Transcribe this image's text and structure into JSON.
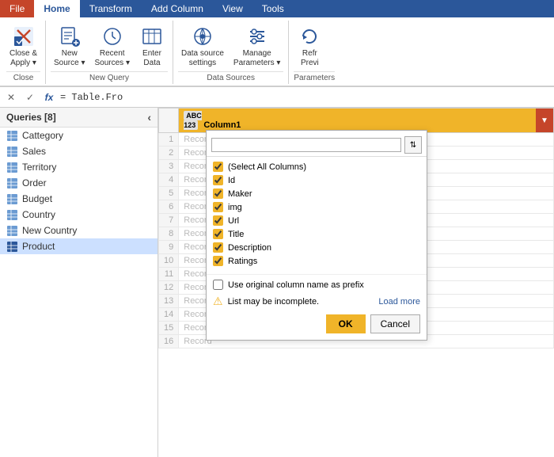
{
  "tabs": {
    "file": "File",
    "home": "Home",
    "transform": "Transform",
    "add_column": "Add Column",
    "view": "View",
    "tools": "Tools"
  },
  "ribbon": {
    "groups": [
      {
        "label": "Close",
        "buttons": [
          {
            "id": "close-apply",
            "label": "Close &\nApply",
            "icon": "✕",
            "dropdown": true
          }
        ]
      },
      {
        "label": "New Query",
        "buttons": [
          {
            "id": "new-source",
            "label": "New\nSource",
            "icon": "📄",
            "dropdown": true
          },
          {
            "id": "recent-sources",
            "label": "Recent\nSources",
            "icon": "🕐",
            "dropdown": true
          },
          {
            "id": "enter-data",
            "label": "Enter\nData",
            "icon": "📊"
          }
        ]
      },
      {
        "label": "Data Sources",
        "buttons": [
          {
            "id": "data-source-settings",
            "label": "Data source\nsettings",
            "icon": "🔌"
          },
          {
            "id": "manage-parameters",
            "label": "Manage\nParameters",
            "icon": "≡",
            "dropdown": true
          }
        ]
      },
      {
        "label": "Parameters",
        "buttons": [
          {
            "id": "refresh-preview",
            "label": "Refr\nPrevi",
            "icon": "↻"
          }
        ]
      }
    ]
  },
  "formula_bar": {
    "cancel_label": "✕",
    "confirm_label": "✓",
    "fx_label": "fx",
    "formula": "= Table.Fro"
  },
  "queries_header": "Queries [8]",
  "queries": [
    {
      "name": "Cattegory",
      "selected": false
    },
    {
      "name": "Sales",
      "selected": false
    },
    {
      "name": "Territory",
      "selected": false
    },
    {
      "name": "Order",
      "selected": false
    },
    {
      "name": "Budget",
      "selected": false
    },
    {
      "name": "Country",
      "selected": false
    },
    {
      "name": "New Country",
      "selected": false
    },
    {
      "name": "Product",
      "selected": true
    }
  ],
  "column": {
    "type": "ABC\n123",
    "name": "Column1"
  },
  "records": [
    {
      "row": 1,
      "value": "Record"
    },
    {
      "row": 2,
      "value": "Record"
    },
    {
      "row": 3,
      "value": "Record"
    },
    {
      "row": 4,
      "value": "Record"
    },
    {
      "row": 5,
      "value": "Record"
    },
    {
      "row": 6,
      "value": "Record"
    },
    {
      "row": 7,
      "value": "Record"
    },
    {
      "row": 8,
      "value": "Record"
    },
    {
      "row": 9,
      "value": "Record"
    },
    {
      "row": 10,
      "value": "Record"
    },
    {
      "row": 11,
      "value": "Record"
    },
    {
      "row": 12,
      "value": "Record"
    },
    {
      "row": 13,
      "value": "Record"
    },
    {
      "row": 14,
      "value": "Record"
    },
    {
      "row": 15,
      "value": "Record"
    },
    {
      "row": 16,
      "value": "Record"
    }
  ],
  "dropdown": {
    "search_placeholder": "",
    "items": [
      {
        "label": "(Select All Columns)",
        "checked": true
      },
      {
        "label": "Id",
        "checked": true
      },
      {
        "label": "Maker",
        "checked": true
      },
      {
        "label": "img",
        "checked": true
      },
      {
        "label": "Url",
        "checked": true
      },
      {
        "label": "Title",
        "checked": true
      },
      {
        "label": "Description",
        "checked": true
      },
      {
        "label": "Ratings",
        "checked": true
      }
    ],
    "prefix_label": "Use original column name as prefix",
    "warning_text": "List may be incomplete.",
    "load_more_label": "Load more",
    "ok_label": "OK",
    "cancel_label": "Cancel"
  }
}
